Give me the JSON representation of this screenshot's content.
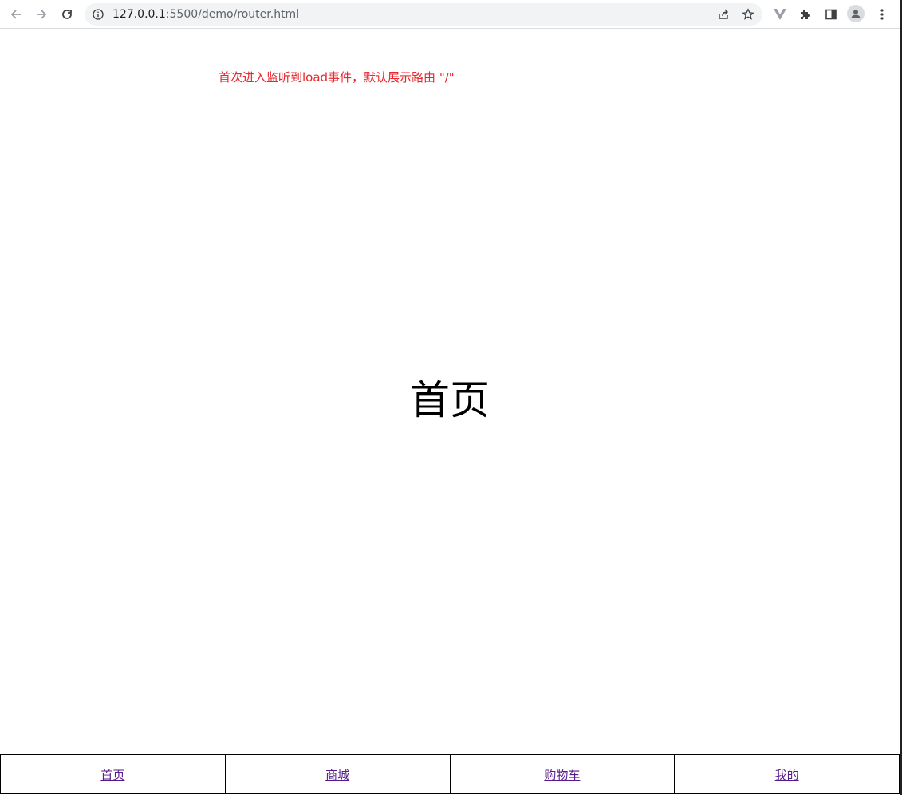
{
  "browser": {
    "url_host": "127.0.0.1",
    "url_rest": ":5500/demo/router.html",
    "icons": {
      "back": "arrow-left-icon",
      "forward": "arrow-right-icon",
      "reload": "reload-icon",
      "site_info": "info-icon",
      "share": "share-icon",
      "bookmark": "star-icon",
      "extension_v": "vue-devtools-icon",
      "extensions": "puzzle-icon",
      "side_panel": "side-panel-icon",
      "profile": "profile-icon",
      "menu": "more-vertical-icon"
    }
  },
  "page": {
    "notice": "首次进入监听到load事件，默认展示路由 \"/\"",
    "heading": "首页",
    "notice_color": "#e8262c",
    "link_color": "#551a8b"
  },
  "tabbar": {
    "items": [
      {
        "label": "首页"
      },
      {
        "label": "商城"
      },
      {
        "label": "购物车"
      },
      {
        "label": "我的"
      }
    ]
  }
}
